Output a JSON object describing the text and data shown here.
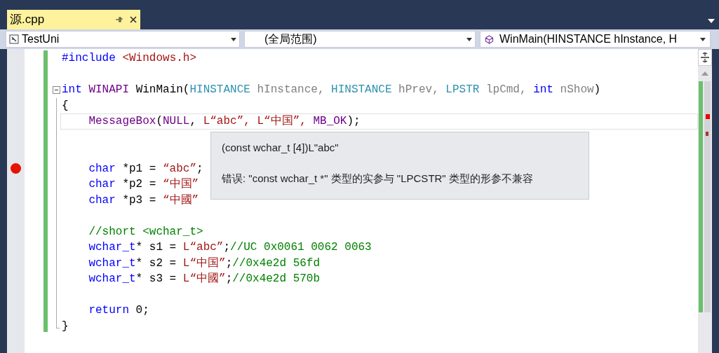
{
  "tab": {
    "title": "源.cpp",
    "selected": true
  },
  "nav": {
    "project": "TestUni",
    "scope": "(全局范围)",
    "member": "WinMain(HINSTANCE hInstance, H"
  },
  "lines": [
    {
      "kind": "code",
      "tokens": [
        {
          "color": "#0000ff",
          "t": "#include"
        },
        {
          "color": "#a31515",
          "t": " <Windows.h>"
        }
      ]
    },
    {
      "kind": "blank"
    },
    {
      "kind": "code",
      "collapsible": true,
      "tokens": [
        {
          "color": "#0000ff",
          "t": "int"
        },
        {
          "color": "#6f008a",
          "t": " WINAPI"
        },
        {
          "color": "#000000",
          "t": " WinMain("
        },
        {
          "color": "#2b91af",
          "t": "HINSTANCE"
        },
        {
          "color": "#808080",
          "t": " hInstance, "
        },
        {
          "color": "#2b91af",
          "t": "HINSTANCE"
        },
        {
          "color": "#808080",
          "t": " hPrev, "
        },
        {
          "color": "#2b91af",
          "t": "LPSTR"
        },
        {
          "color": "#808080",
          "t": " lpCmd, "
        },
        {
          "color": "#0000ff",
          "t": "int"
        },
        {
          "color": "#808080",
          "t": " nShow"
        },
        {
          "color": "#000000",
          "t": ")"
        }
      ]
    },
    {
      "kind": "code",
      "tokens": [
        {
          "color": "#000000",
          "t": "{"
        }
      ],
      "children": [
        {
          "kind": "code",
          "current": true,
          "tokens": [
            {
              "color": "#6f008a",
              "t": "MessageBox"
            },
            {
              "color": "#000000",
              "t": "("
            },
            {
              "color": "#6f008a",
              "t": "NULL"
            },
            {
              "color": "#000000",
              "t": ", "
            },
            {
              "color": "#a31515",
              "t": "L“abc”, "
            },
            {
              "color": "#a31515",
              "t": "L“中国”, "
            },
            {
              "color": "#6f008a",
              "t": "MB_OK"
            },
            {
              "color": "#000000",
              "t": ");"
            }
          ]
        },
        {
          "kind": "blank"
        },
        {
          "kind": "blank"
        },
        {
          "kind": "code",
          "breakpoint": true,
          "tokens": [
            {
              "color": "#0000ff",
              "t": "char"
            },
            {
              "color": "#000000",
              "t": " *p1 = "
            },
            {
              "color": "#a31515",
              "t": "“abc”"
            },
            {
              "color": "#000000",
              "t": ";"
            }
          ]
        },
        {
          "kind": "code",
          "tokens": [
            {
              "color": "#0000ff",
              "t": "char"
            },
            {
              "color": "#000000",
              "t": " *p2 = "
            },
            {
              "color": "#a31515",
              "t": "“中国”"
            }
          ]
        },
        {
          "kind": "code",
          "tokens": [
            {
              "color": "#0000ff",
              "t": "char"
            },
            {
              "color": "#000000",
              "t": " *p3 = "
            },
            {
              "color": "#a31515",
              "t": "“中國”"
            }
          ]
        },
        {
          "kind": "blank"
        },
        {
          "kind": "code",
          "tokens": [
            {
              "color": "#008000",
              "t": "//short <wchar_t>"
            }
          ]
        },
        {
          "kind": "code",
          "tokens": [
            {
              "color": "#0000ff",
              "t": "wchar_t"
            },
            {
              "color": "#000000",
              "t": "* s1 = "
            },
            {
              "color": "#a31515",
              "t": "L“abc”"
            },
            {
              "color": "#000000",
              "t": ";"
            },
            {
              "color": "#008000",
              "t": "//UC 0x0061 0062 0063"
            }
          ]
        },
        {
          "kind": "code",
          "tokens": [
            {
              "color": "#0000ff",
              "t": "wchar_t"
            },
            {
              "color": "#000000",
              "t": "* s2 = "
            },
            {
              "color": "#a31515",
              "t": "L“中国”"
            },
            {
              "color": "#000000",
              "t": ";"
            },
            {
              "color": "#008000",
              "t": "//0x4e2d 56fd"
            }
          ]
        },
        {
          "kind": "code",
          "tokens": [
            {
              "color": "#0000ff",
              "t": "wchar_t"
            },
            {
              "color": "#000000",
              "t": "* s3 = "
            },
            {
              "color": "#a31515",
              "t": "L“中國”"
            },
            {
              "color": "#000000",
              "t": ";"
            },
            {
              "color": "#008000",
              "t": "//0x4e2d 570b"
            }
          ]
        },
        {
          "kind": "blank"
        },
        {
          "kind": "code",
          "tokens": [
            {
              "color": "#0000ff",
              "t": "return"
            },
            {
              "color": "#000000",
              "t": " 0;"
            }
          ]
        }
      ]
    },
    {
      "kind": "code",
      "tokens": [
        {
          "color": "#000000",
          "t": "}"
        }
      ]
    }
  ],
  "tooltip": {
    "signature": "(const wchar_t [4])L\"abc\"",
    "error": "错误: \"const wchar_t *\" 类型的实参与 \"LPCSTR\" 类型的形参不兼容"
  }
}
